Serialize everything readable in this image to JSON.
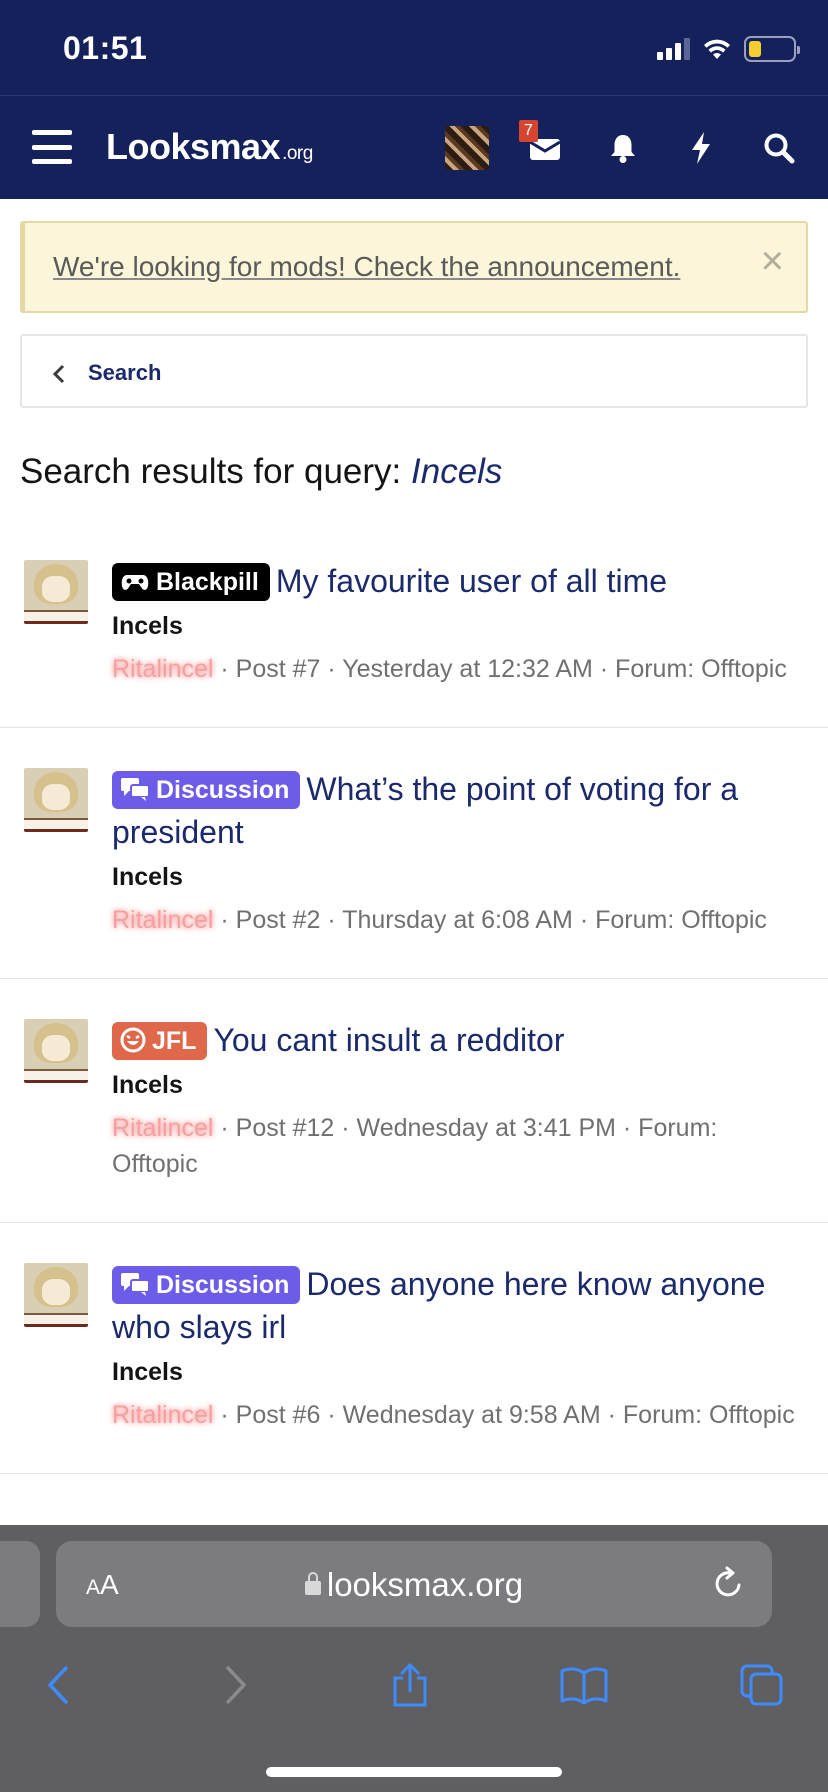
{
  "status_bar": {
    "time": "01:51"
  },
  "header": {
    "logo_main": "Looksmax",
    "logo_suffix": ".org",
    "inbox_badge": "7",
    "icons": [
      "menu-icon",
      "avatar",
      "inbox-icon",
      "bell-icon",
      "lightning-icon",
      "search-icon"
    ]
  },
  "notice": {
    "text": "We're looking for mods! Check the announcement.",
    "close": "×"
  },
  "breadcrumb": {
    "label": "Search"
  },
  "heading": {
    "prefix": "Search results for query: ",
    "query": "Incels"
  },
  "results": [
    {
      "label": "Blackpill",
      "label_color": "#000000",
      "label_icon": "gamepad-icon",
      "title": "My favourite user of all time",
      "forum_tag": "Incels",
      "user": "Ritalincel",
      "meta": " · Post #7 · Yesterday at 12:32 AM · Forum: Offtopic"
    },
    {
      "label": "Discussion",
      "label_color": "#6c5ce7",
      "label_icon": "chat-icon",
      "title": "What’s the point of voting for a president",
      "forum_tag": "Incels",
      "user": "Ritalincel",
      "meta": " · Post #2 · Thursday at 6:08 AM · Forum: Offtopic"
    },
    {
      "label": "JFL",
      "label_color": "#e0684a",
      "label_icon": "laugh-icon",
      "title": "You cant insult a redditor",
      "forum_tag": "Incels",
      "user": "Ritalincel",
      "meta": " · Post #12 · Wednesday at 3:41 PM · Forum: Offtopic"
    },
    {
      "label": "Discussion",
      "label_color": "#6c5ce7",
      "label_icon": "chat-icon",
      "title": "Does anyone here know anyone who slays irl",
      "forum_tag": "Incels",
      "user": "Ritalincel",
      "meta": " · Post #6 · Wednesday at 9:58 AM · Forum: Offtopic"
    }
  ],
  "browser": {
    "text_size_label_small": "A",
    "text_size_label_large": "A",
    "url": "looksmax.org"
  },
  "colors": {
    "header_bg": "#14215a",
    "link": "#1b2a6b",
    "notice_bg": "#fbf6da"
  }
}
